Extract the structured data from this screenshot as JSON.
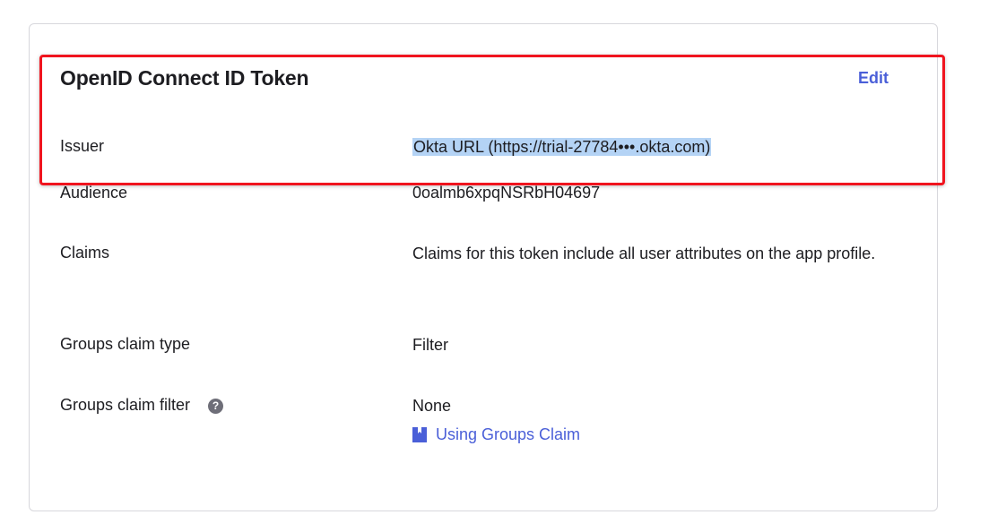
{
  "section": {
    "title": "OpenID Connect ID Token",
    "edit_label": "Edit"
  },
  "rows": [
    {
      "label": "Issuer",
      "value": "Okta URL (https://trial-27784•••.okta.com)"
    },
    {
      "label": "Audience",
      "value": "0oalmb6xpqNSRbH04697"
    },
    {
      "label": "Claims",
      "value": "Claims for this token include all user attributes on the app profile."
    },
    {
      "label": "Groups claim type",
      "value": "Filter"
    },
    {
      "label": "Groups claim filter",
      "value": "None",
      "help_icon": "?"
    }
  ],
  "help_link": {
    "label": "Using Groups Claim",
    "icon": "book-icon"
  },
  "colors": {
    "accent": "#4a5fd8",
    "highlight": "#f0141e",
    "selection": "#b4d3f5"
  }
}
